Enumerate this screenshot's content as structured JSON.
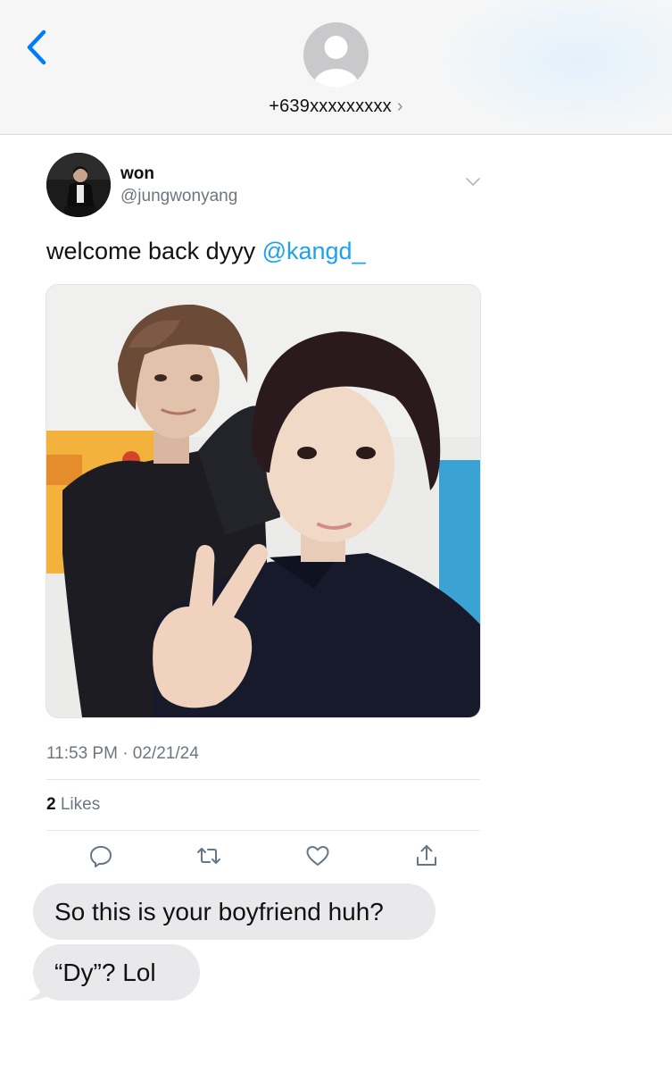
{
  "header": {
    "contact_number": "+639xxxxxxxxx",
    "chevron": "›",
    "back_icon": "chevron-left-icon"
  },
  "tweet": {
    "display_name": "won",
    "handle": "@jungwonyang",
    "text": "welcome back dyyy ",
    "mention": "@kangd_",
    "timestamp": "11:53 PM · 02/21/24",
    "likes_count": "2",
    "likes_label": " Likes",
    "actions": [
      "reply-icon",
      "retweet-icon",
      "like-icon",
      "share-icon"
    ]
  },
  "messages": [
    {
      "text": "So this is your boyfriend huh?",
      "sender": "contact"
    },
    {
      "text": "“Dy”? Lol",
      "sender": "contact"
    }
  ],
  "colors": {
    "accent": "#007aff",
    "mention": "#1da1f2",
    "bubble": "#e9e9eb",
    "secondary_text": "#6e767d"
  }
}
